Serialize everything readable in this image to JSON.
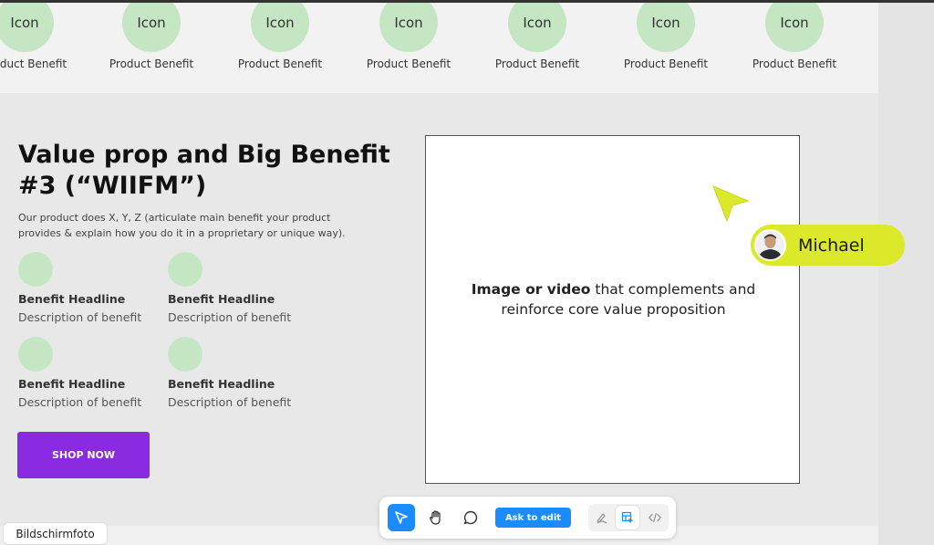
{
  "icon_row": {
    "items": [
      {
        "icon": "Icon",
        "label": "Product Benefit"
      },
      {
        "icon": "Icon",
        "label": "Product Benefit"
      },
      {
        "icon": "Icon",
        "label": "Product Benefit"
      },
      {
        "icon": "Icon",
        "label": "Product Benefit"
      },
      {
        "icon": "Icon",
        "label": "Product Benefit"
      },
      {
        "icon": "Icon",
        "label": "Product Benefit"
      },
      {
        "icon": "Icon",
        "label": "Product Benefit"
      }
    ]
  },
  "hero": {
    "headline": "Value prop and Big Benefit #3 (“WIIFM”)",
    "lead": "Our product does X, Y, Z (articulate main benefit your product provides & explain how you do it in a proprietary or unique way).",
    "benefits": [
      {
        "headline": "Benefit Headline",
        "description": "Description of benefit"
      },
      {
        "headline": "Benefit Headline",
        "description": "Description of benefit"
      },
      {
        "headline": "Benefit Headline",
        "description": "Description of benefit"
      },
      {
        "headline": "Benefit Headline",
        "description": "Description of benefit"
      }
    ],
    "cta_label": "SHOP NOW"
  },
  "media": {
    "text_bold": "Image or video",
    "text_rest": " that complements and reinforce core value proposition"
  },
  "collaborator": {
    "name": "Michael",
    "color": "#dce82a"
  },
  "toolbar": {
    "ask_label": "Ask to edit",
    "tools": [
      "pointer-icon",
      "hand-icon",
      "comment-icon",
      "draw-icon",
      "inspect-icon",
      "code-icon"
    ],
    "accent": "#1a8cff"
  },
  "tooltip": {
    "text": "Bildschirmfoto"
  },
  "colors": {
    "cta": "#8a2be2",
    "icon_circle": "#c5e6c3"
  }
}
